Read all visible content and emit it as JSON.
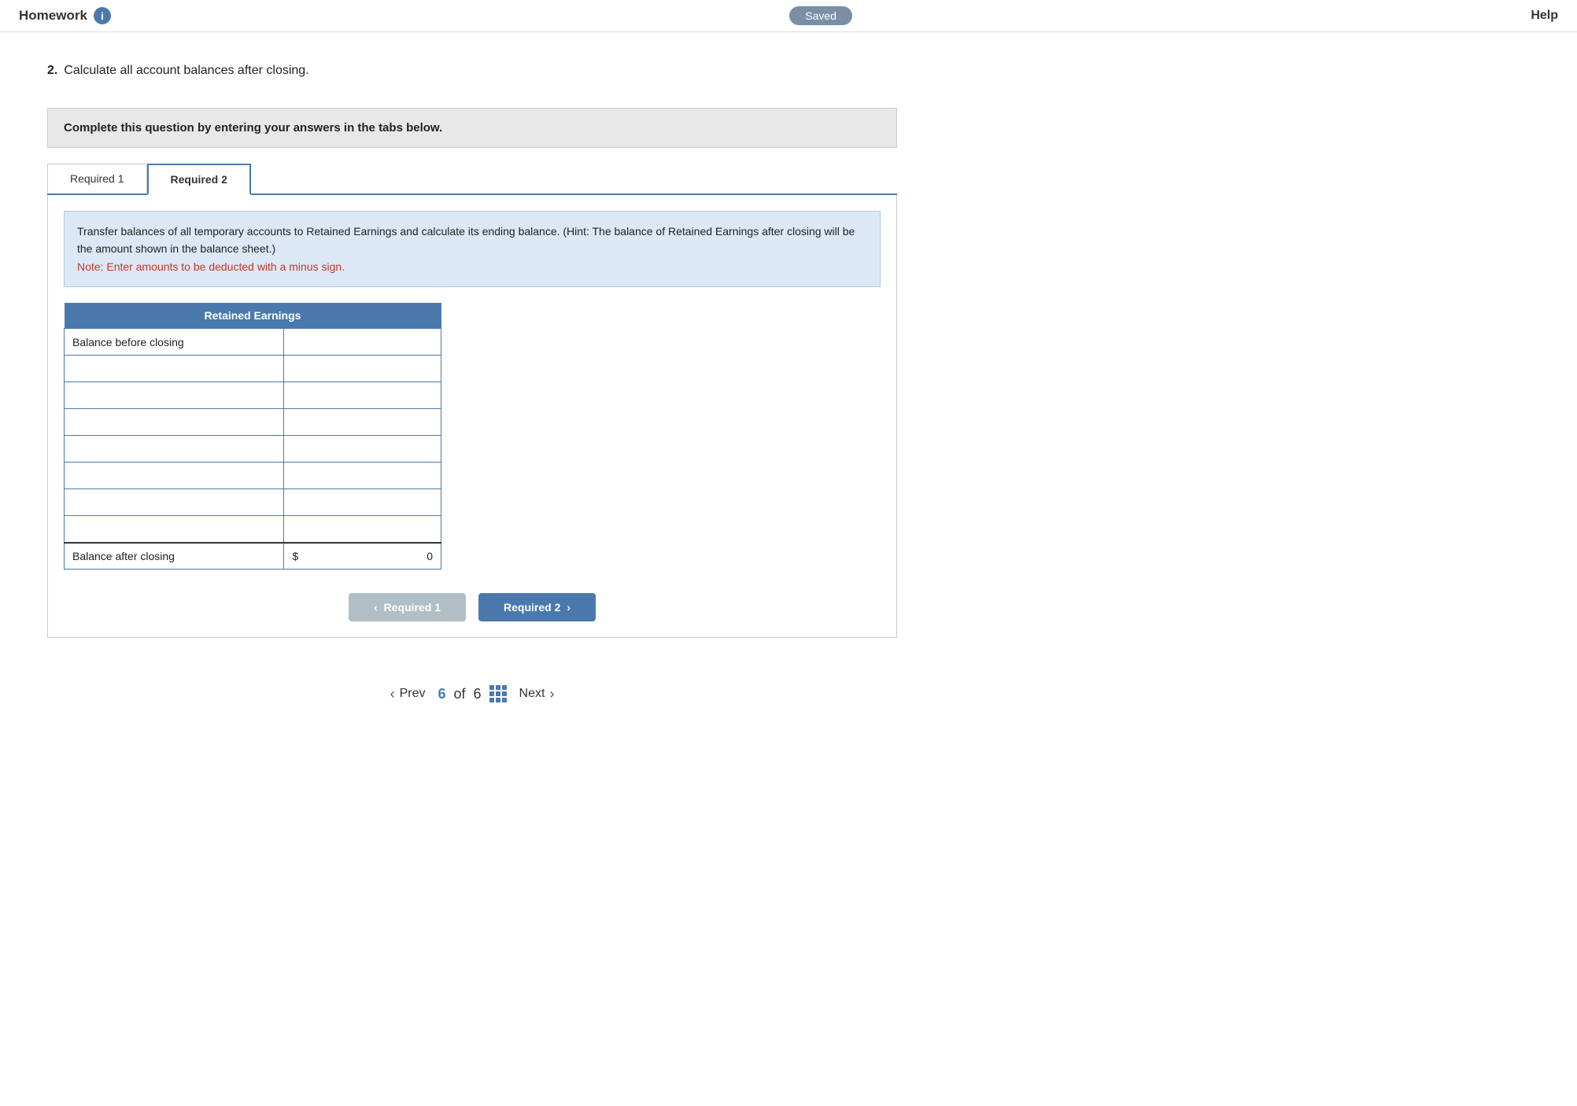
{
  "header": {
    "app_name": "Homework",
    "info_icon": "i",
    "saved_label": "Saved",
    "help_label": "Help"
  },
  "question": {
    "number": "2.",
    "text": "Calculate all account balances after closing."
  },
  "complete_box": {
    "text": "Complete this question by entering your answers in the tabs below."
  },
  "tabs": [
    {
      "id": "req1",
      "label": "Required 1",
      "active": false
    },
    {
      "id": "req2",
      "label": "Required 2",
      "active": true
    }
  ],
  "instruction": {
    "main_text": "Transfer balances of all temporary accounts to Retained Earnings and calculate its ending balance. (Hint: The balance of Retained Earnings after closing will be the amount shown in the balance sheet.)",
    "note": "Note: Enter amounts to be deducted with a minus sign."
  },
  "table": {
    "header": "Retained Earnings",
    "rows": [
      {
        "label": "Balance before closing",
        "value": "",
        "type": "input"
      },
      {
        "label": "",
        "value": "",
        "type": "input"
      },
      {
        "label": "",
        "value": "",
        "type": "input"
      },
      {
        "label": "",
        "value": "",
        "type": "input"
      },
      {
        "label": "",
        "value": "",
        "type": "input"
      },
      {
        "label": "",
        "value": "",
        "type": "input"
      },
      {
        "label": "",
        "value": "",
        "type": "input"
      },
      {
        "label": "",
        "value": "",
        "type": "input"
      }
    ],
    "balance_after_label": "Balance after closing",
    "balance_after_symbol": "$",
    "balance_after_value": "0"
  },
  "nav_buttons": {
    "prev_label": "Required 1",
    "next_label": "Required 2"
  },
  "pagination": {
    "prev_label": "Prev",
    "current_page": "6",
    "of_text": "of",
    "total_pages": "6",
    "next_label": "Next"
  }
}
